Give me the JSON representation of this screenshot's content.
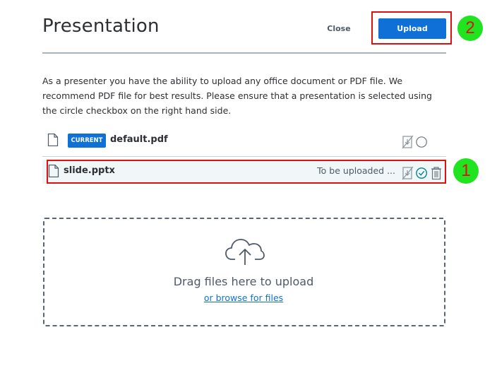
{
  "header": {
    "title": "Presentation",
    "close_label": "Close",
    "upload_label": "Upload"
  },
  "annotations": {
    "marker_1": "1",
    "marker_2": "2"
  },
  "description": "As a presenter you have the ability to upload any office document or PDF file. We recommend PDF file for best results. Please ensure that a presentation is selected using the circle checkbox on the right hand side.",
  "files": [
    {
      "badge": "CURRENT",
      "name": "default.pdf",
      "status": "",
      "selected": false
    },
    {
      "badge": "",
      "name": "slide.pptx",
      "status": "To be uploaded ...",
      "selected": true
    }
  ],
  "dropzone": {
    "drag_text": "Drag files here to upload",
    "browse_text": "or browse for files"
  },
  "colors": {
    "accent": "#0f70d7",
    "highlight": "#e01010",
    "marker_bg": "#1fe41f",
    "selected_check": "#00808c"
  }
}
